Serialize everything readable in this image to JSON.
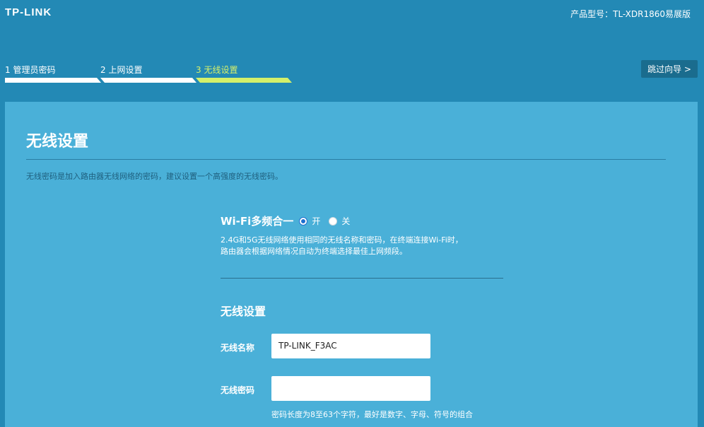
{
  "header": {
    "logo": "TP-LINK",
    "model_label": "产品型号：TL-XDR1860易展版"
  },
  "steps": [
    {
      "label": "1 管理员密码"
    },
    {
      "label": "2 上网设置"
    },
    {
      "label": "3 无线设置",
      "active": true
    }
  ],
  "skip_button": {
    "label": "跳过向导 >"
  },
  "panel": {
    "title": "无线设置",
    "description": "无线密码是加入路由器无线网络的密码，建议设置一个高强度的无线密码。"
  },
  "wifi_combine": {
    "title": "Wi-Fi多频合一",
    "option_on": "开",
    "option_off": "关",
    "selected": "开",
    "desc_line1": "2.4G和5G无线网络使用相同的无线名称和密码，在终端连接Wi-Fi时，",
    "desc_line2": "路由器会根据网络情况自动为终端选择最佳上网频段。"
  },
  "wireless": {
    "section_title": "无线设置",
    "name_label": "无线名称",
    "name_value": "TP-LINK_F3AC",
    "password_label": "无线密码",
    "password_value": "",
    "password_hint": "密码长度为8至63个字符，最好是数字、字母、符号的组合"
  },
  "colors": {
    "background": "#2389b5",
    "panel": "#4ab0d8",
    "active_step": "#d4f06a",
    "skip_button": "#1a6c8e"
  }
}
